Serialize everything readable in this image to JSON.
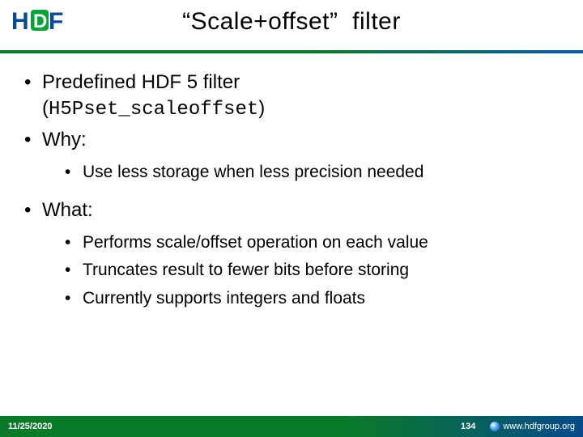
{
  "title": "“Scale+offset”  filter",
  "bullets": {
    "b1_prefix": "Predefined HDF 5 filter ",
    "b1_code_open": "(",
    "b1_code": "H5Pset_scaleoffset",
    "b1_code_close": ")",
    "b2": "Why:",
    "b2_sub1": "Use less storage when less precision needed",
    "b3": "What:",
    "b3_sub1": "Performs scale/offset operation on each value",
    "b3_sub2": "Truncates result to fewer bits before storing",
    "b3_sub3": "Currently supports integers and floats"
  },
  "footer": {
    "date": "11/25/2020",
    "page": "134",
    "org": "www.hdfgroup.org"
  },
  "logo": {
    "h": "H",
    "d": "D",
    "f": "F"
  }
}
